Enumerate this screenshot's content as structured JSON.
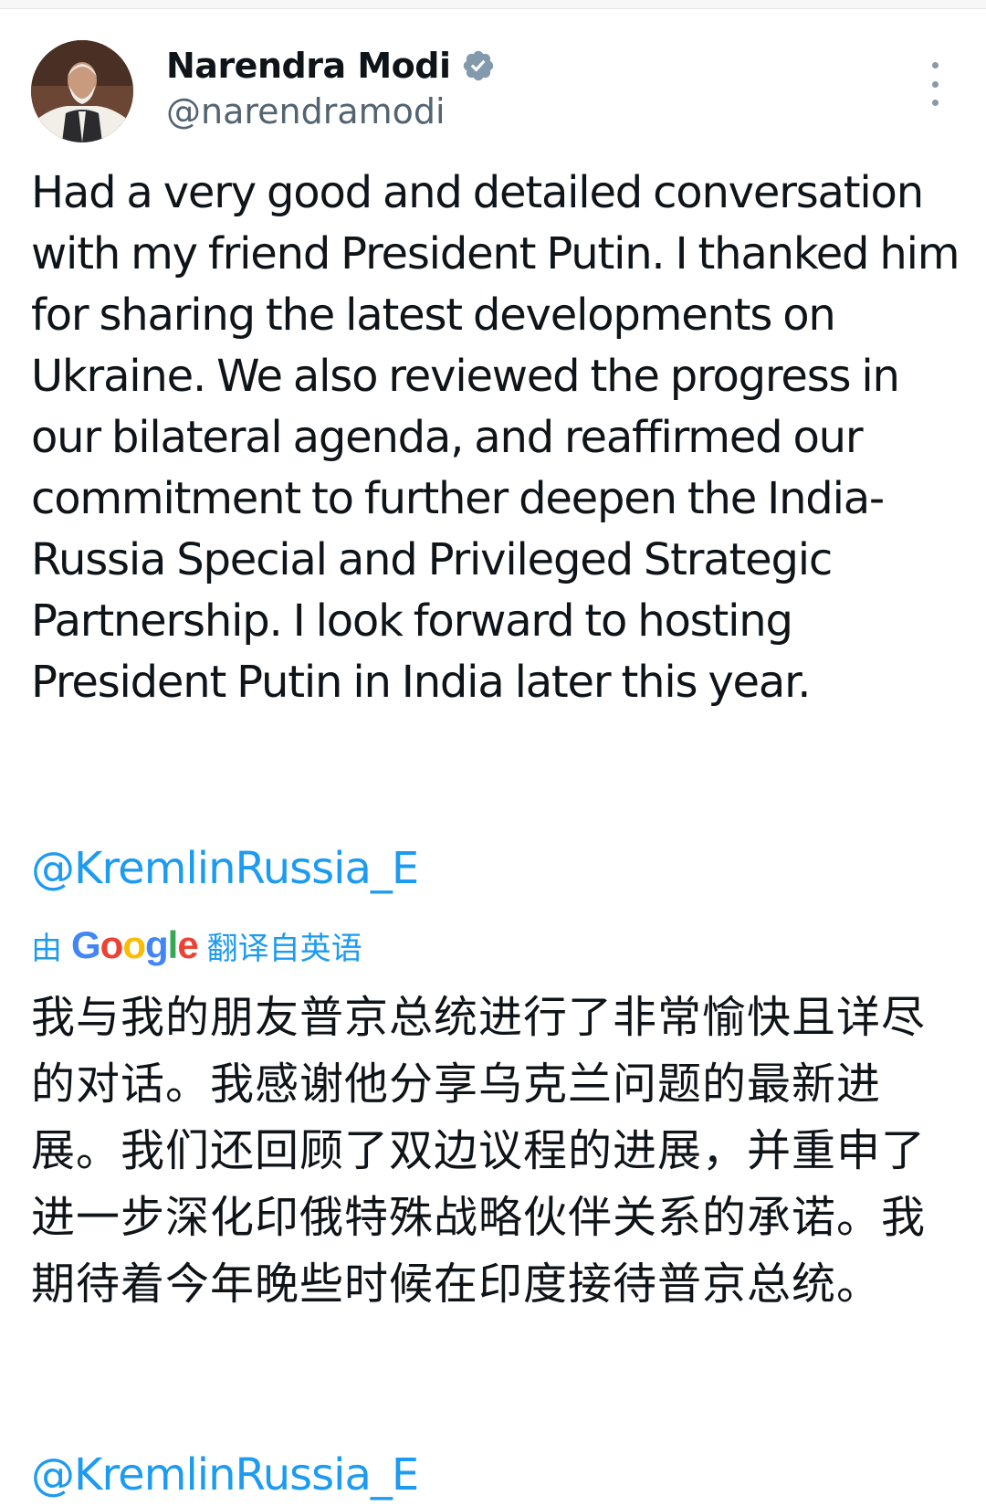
{
  "post": {
    "author": {
      "name": "Narendra Modi",
      "handle": "@narendramodi",
      "verified_icon": "verified-badge-icon",
      "verified_color": "#829aab"
    },
    "more_icon": "more-vertical-icon",
    "text": "Had a very good and detailed conversation with my friend President Putin. I thanked him for sharing the latest developments on Ukraine. We also reviewed the progress in our bilateral agenda, and reaffirmed our commitment to further deepen the India-Russia Special and Privileged Strategic Partnership. I look forward to hosting President Putin in India later this year.",
    "mention": "@KremlinRussia_E",
    "translation": {
      "prefix": "由",
      "provider": "Google",
      "suffix": "翻译自英语",
      "text": "我与我的朋友普京总统进行了非常愉快且详尽的对话。我感谢他分享乌克兰问题的最新进展。我们还回顾了双边议程的进展，并重申了进一步深化印俄特殊战略伙伴关系的承诺。我期待着今年晚些时候在印度接待普京总统。",
      "mention": "@KremlinRussia_E"
    },
    "link_color": "#1d9bf0"
  }
}
